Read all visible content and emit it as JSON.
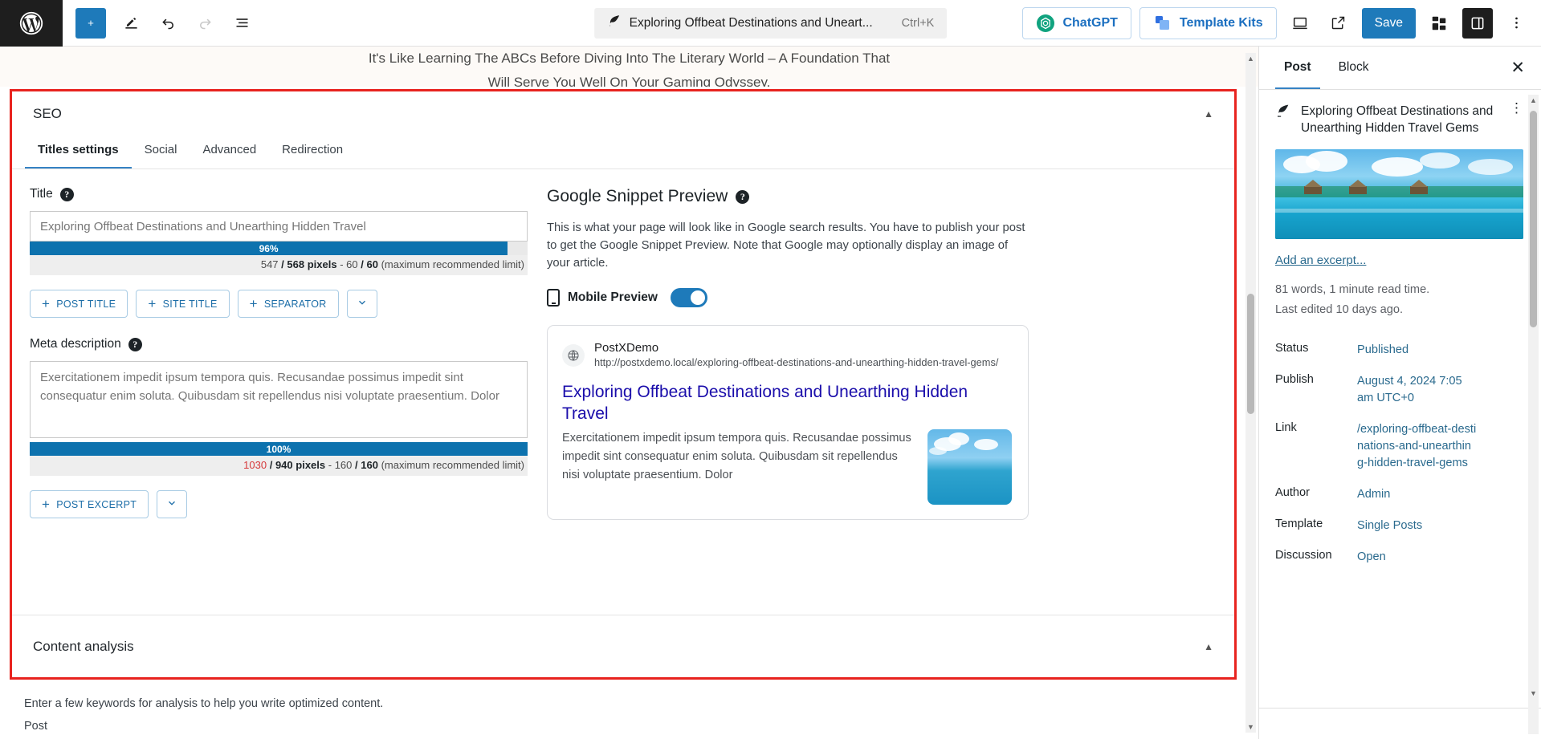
{
  "topbar": {
    "logo_icon": "wordpress-logo-icon",
    "add_block_label": "+",
    "tools": [
      "edit-pencil-icon",
      "undo-icon",
      "redo-icon",
      "list-view-icon"
    ],
    "document_title": "Exploring Offbeat Destinations and Uneart...",
    "document_icon": "feather-icon",
    "shortcut": "Ctrl+K",
    "chatgpt_label": "ChatGPT",
    "template_kits_label": "Template Kits",
    "preview_icon": "desktop-preview-icon",
    "view_icon": "external-link-icon",
    "save_label": "Save",
    "plugin_icon": "blocks-icon",
    "settings_icon": "sidebar-toggle-icon",
    "options_icon": "kebab-menu-icon"
  },
  "editor": {
    "peek_line_1": "It's Like Learning The ABCs Before Diving Into The Literary World – A Foundation That",
    "peek_line_2": "Will Serve You Well On Your Gaming Odyssey.",
    "below_note": "Enter a few keywords for analysis to help you write optimized content.",
    "breadcrumb": "Post"
  },
  "seo": {
    "panel_title": "SEO",
    "collapse_icon": "chevron-up-icon",
    "tabs": [
      {
        "label": "Titles settings",
        "active": true
      },
      {
        "label": "Social",
        "active": false
      },
      {
        "label": "Advanced",
        "active": false
      },
      {
        "label": "Redirection",
        "active": false
      }
    ],
    "title_field": {
      "label": "Title",
      "help_icon": "question-mark-icon",
      "value": "Exploring Offbeat Destinations and Unearthing Hidden Travel",
      "percent": "96%",
      "percent_value": 96,
      "pixels_current": "547",
      "pixels_max": "568",
      "unit_label": "pixels",
      "chars_current": "60",
      "chars_max": "60",
      "limit_note": "(maximum recommended limit)",
      "over_limit": false
    },
    "title_buttons": [
      {
        "label": "POST TITLE",
        "icon": "plus-icon"
      },
      {
        "label": "SITE TITLE",
        "icon": "plus-icon"
      },
      {
        "label": "SEPARATOR",
        "icon": "plus-icon"
      }
    ],
    "title_more_icon": "chevron-down-icon",
    "meta_field": {
      "label": "Meta description",
      "help_icon": "question-mark-icon",
      "value": "Exercitationem impedit ipsum tempora quis. Recusandae possimus impedit sint consequatur enim soluta. Quibusdam sit repellendus nisi voluptate praesentium. Dolor",
      "percent": "100%",
      "percent_value": 100,
      "pixels_current": "1030",
      "pixels_max": "940",
      "unit_label": "pixels",
      "chars_current": "160",
      "chars_max": "160",
      "limit_note": "(maximum recommended limit)",
      "over_limit": true
    },
    "meta_buttons": [
      {
        "label": "POST EXCERPT",
        "icon": "plus-icon"
      }
    ],
    "meta_more_icon": "chevron-down-icon",
    "content_analysis_title": "Content analysis",
    "content_analysis_icon": "chevron-up-icon"
  },
  "snippet": {
    "heading": "Google Snippet Preview",
    "help_icon": "question-mark-icon",
    "description": "This is what your page will look like in Google search results. You have to publish your post to get the Google Snippet Preview. Note that Google may optionally display an image of your article.",
    "mobile_preview_label": "Mobile Preview",
    "mobile_preview_icon": "mobile-phone-icon",
    "mobile_preview_on": true,
    "site_name": "PostXDemo",
    "url": "http://postxdemo.local/exploring-offbeat-destinations-and-unearthing-hidden-travel-gems/",
    "result_title": "Exploring Offbeat Destinations and Unearthing Hidden Travel",
    "result_description": "Exercitationem impedit ipsum tempora quis. Recusandae possimus impedit sint consequatur enim soluta. Quibusdam sit repellendus nisi voluptate praesentium. Dolor",
    "thumbnail_alt": "tropical-beach-thumbnail"
  },
  "sidebar": {
    "tabs": [
      {
        "label": "Post",
        "active": true
      },
      {
        "label": "Block",
        "active": false
      }
    ],
    "close_icon": "close-icon",
    "post_icon": "feather-icon",
    "post_title": "Exploring Offbeat Destinations and Unearthing Hidden Travel Gems",
    "kebab_icon": "kebab-menu-icon",
    "featured_image_alt": "tropical-overwater-bungalows",
    "excerpt_link": "Add an excerpt...",
    "word_count": "81 words, 1 minute read time.",
    "last_edited": "Last edited 10 days ago.",
    "rows": [
      {
        "key": "Status",
        "value": "Published"
      },
      {
        "key": "Publish",
        "value": "August 4, 2024 7:05 am UTC+0"
      },
      {
        "key": "Link",
        "value": "/exploring-offbeat-destinations-and-unearthing-hidden-travel-gems"
      },
      {
        "key": "Author",
        "value": "Admin"
      },
      {
        "key": "Template",
        "value": "Single Posts"
      },
      {
        "key": "Discussion",
        "value": "Open"
      }
    ]
  },
  "colors": {
    "wp_blue": "#1e7aba",
    "accent_link": "#2a6a8e",
    "highlight_red": "#e8231f",
    "bar_blue": "#0d72ae",
    "google_link": "#1a0dab",
    "over_limit_red": "#d63638"
  }
}
